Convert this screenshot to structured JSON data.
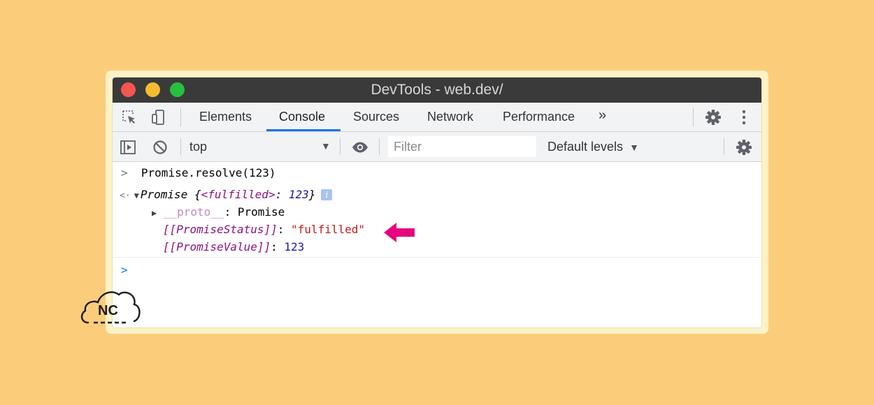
{
  "colors": {
    "background": "#fbcd7b",
    "accent": "#1a73e8",
    "arrow": "#e5007f"
  },
  "window": {
    "title": "DevTools - web.dev/"
  },
  "tabs": [
    {
      "label": "Elements",
      "active": false
    },
    {
      "label": "Console",
      "active": true
    },
    {
      "label": "Sources",
      "active": false
    },
    {
      "label": "Network",
      "active": false
    },
    {
      "label": "Performance",
      "active": false
    }
  ],
  "tabbar": {
    "more_tabs_glyph": "»",
    "icons": [
      "inspect-element-icon",
      "device-toolbar-icon",
      "gear-icon",
      "more-vert-icon"
    ]
  },
  "toolbar": {
    "context": "top",
    "filter_placeholder": "Filter",
    "levels_label": "Default levels",
    "icons": [
      "sidebar-toggle-icon",
      "clear-console-icon",
      "eye-icon",
      "gear-icon"
    ]
  },
  "console": {
    "input_command": "Promise.resolve(123)",
    "result_label": "Promise",
    "result_open_brace": "{",
    "result_key": "<fulfilled>",
    "result_sep": ": ",
    "result_value": "123",
    "result_close_brace": "}",
    "proto_key": "__proto__",
    "proto_sep": ": ",
    "proto_value": "Promise",
    "status_key": "[[PromiseStatus]]",
    "status_sep": ": ",
    "status_value": "\"fulfilled\"",
    "value_key": "[[PromiseValue]]",
    "value_sep": ": ",
    "value_value": "123",
    "info_badge": "i"
  },
  "watermark": {
    "text": "NC"
  }
}
